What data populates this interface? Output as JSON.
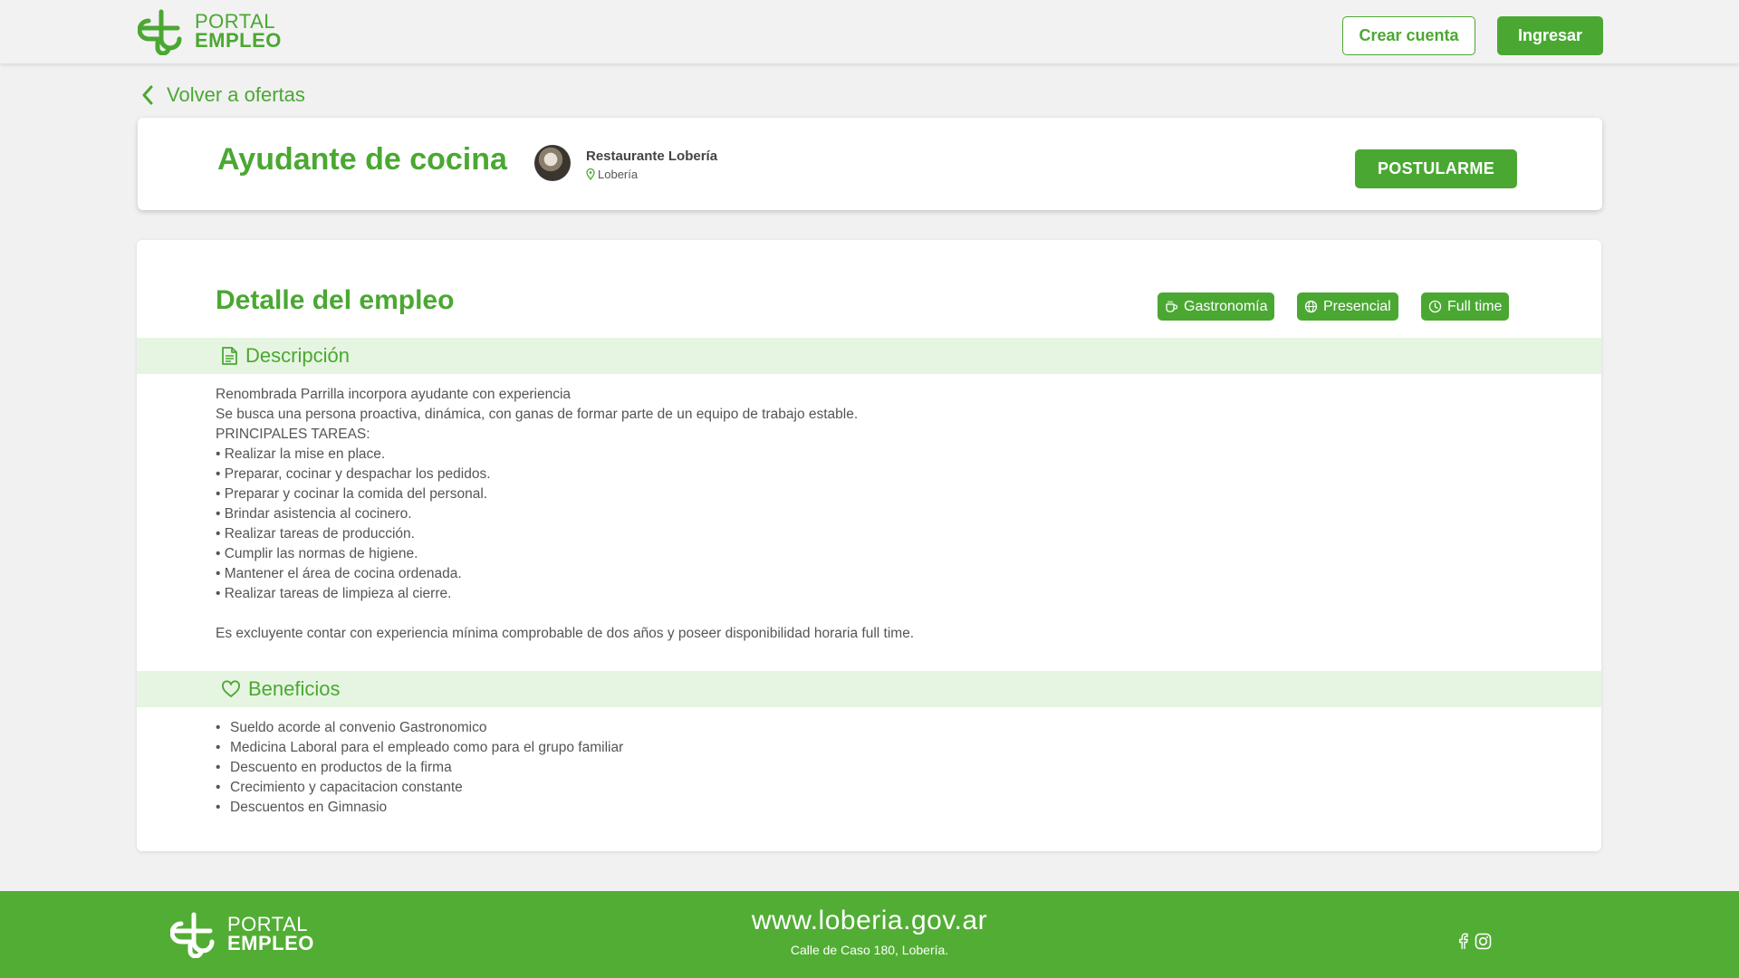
{
  "brand": {
    "line1": "PORTAL",
    "line2": "EMPLEO",
    "accent_color": "#4aa832",
    "light_accent": "#e6f5e1"
  },
  "header": {
    "create_account_label": "Crear cuenta",
    "login_label": "Ingresar"
  },
  "nav": {
    "back_label": "Volver a ofertas"
  },
  "job": {
    "title": "Ayudante de cocina",
    "company": "Restaurante Lobería",
    "location": "Lobería",
    "apply_label": "POSTULARME"
  },
  "detail": {
    "title": "Detalle del empleo",
    "tags": [
      {
        "label": "Gastronomía",
        "icon": "coffee-cup-icon"
      },
      {
        "label": "Presencial",
        "icon": "globe-icon"
      },
      {
        "label": "Full time",
        "icon": "clock-icon"
      }
    ],
    "description_heading": "Descripción",
    "description_lines": [
      "Renombrada Parrilla incorpora ayudante con experiencia",
      "Se busca una persona proactiva, dinámica, con ganas de formar parte de un equipo de trabajo estable.",
      "PRINCIPALES TAREAS:",
      "•  Realizar la mise en place.",
      "•  Preparar, cocinar y despachar los pedidos.",
      "• Preparar y cocinar la comida del personal.",
      "• Brindar asistencia al cocinero.",
      "• Realizar tareas de producción.",
      "• Cumplir las normas de higiene.",
      "• Mantener el área de cocina ordenada.",
      "• Realizar tareas de limpieza al cierre.",
      "",
      "Es excluyente contar con experiencia mínima comprobable de dos años y poseer disponibilidad horaria full time."
    ],
    "benefits_heading": "Beneficios",
    "benefits": [
      "Sueldo acorde al convenio Gastronomico",
      "Medicina Laboral para el empleado como para el grupo familiar",
      "Descuento en productos de la firma",
      "Crecimiento y capacitacion constante",
      "Descuentos en Gimnasio"
    ]
  },
  "footer": {
    "site": "www.loberia.gov.ar",
    "address": "Calle de Caso 180, Lobería.",
    "social_icons": [
      "facebook-icon",
      "instagram-icon"
    ]
  }
}
